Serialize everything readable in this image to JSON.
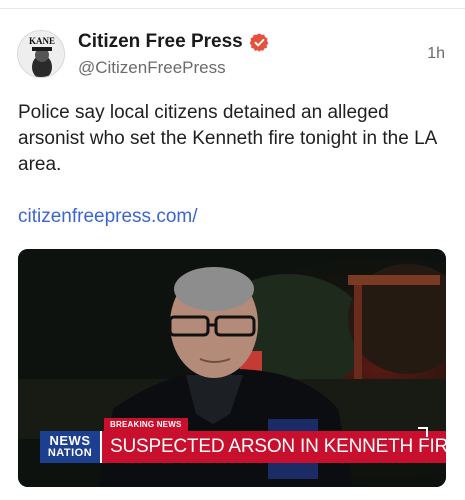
{
  "post": {
    "display_name": "Citizen Free Press",
    "handle": "@CitizenFreePress",
    "time": "1h",
    "text": "Police say local citizens detained an alleged arsonist who set the Kenneth fire tonight in the LA area.",
    "link": "citizenfreepress.com/",
    "avatar_text": "KANE"
  },
  "media": {
    "breaking_label": "BREAKING NEWS",
    "network_line1": "NEWS",
    "network_line2": "NATION",
    "headline": "SUSPECTED ARSON IN KENNETH FIRE"
  },
  "colors": {
    "link": "#3b65d4",
    "verified": "#e5533f",
    "chyron_red": "#c8102e",
    "network_blue": "#1c3f8f"
  }
}
